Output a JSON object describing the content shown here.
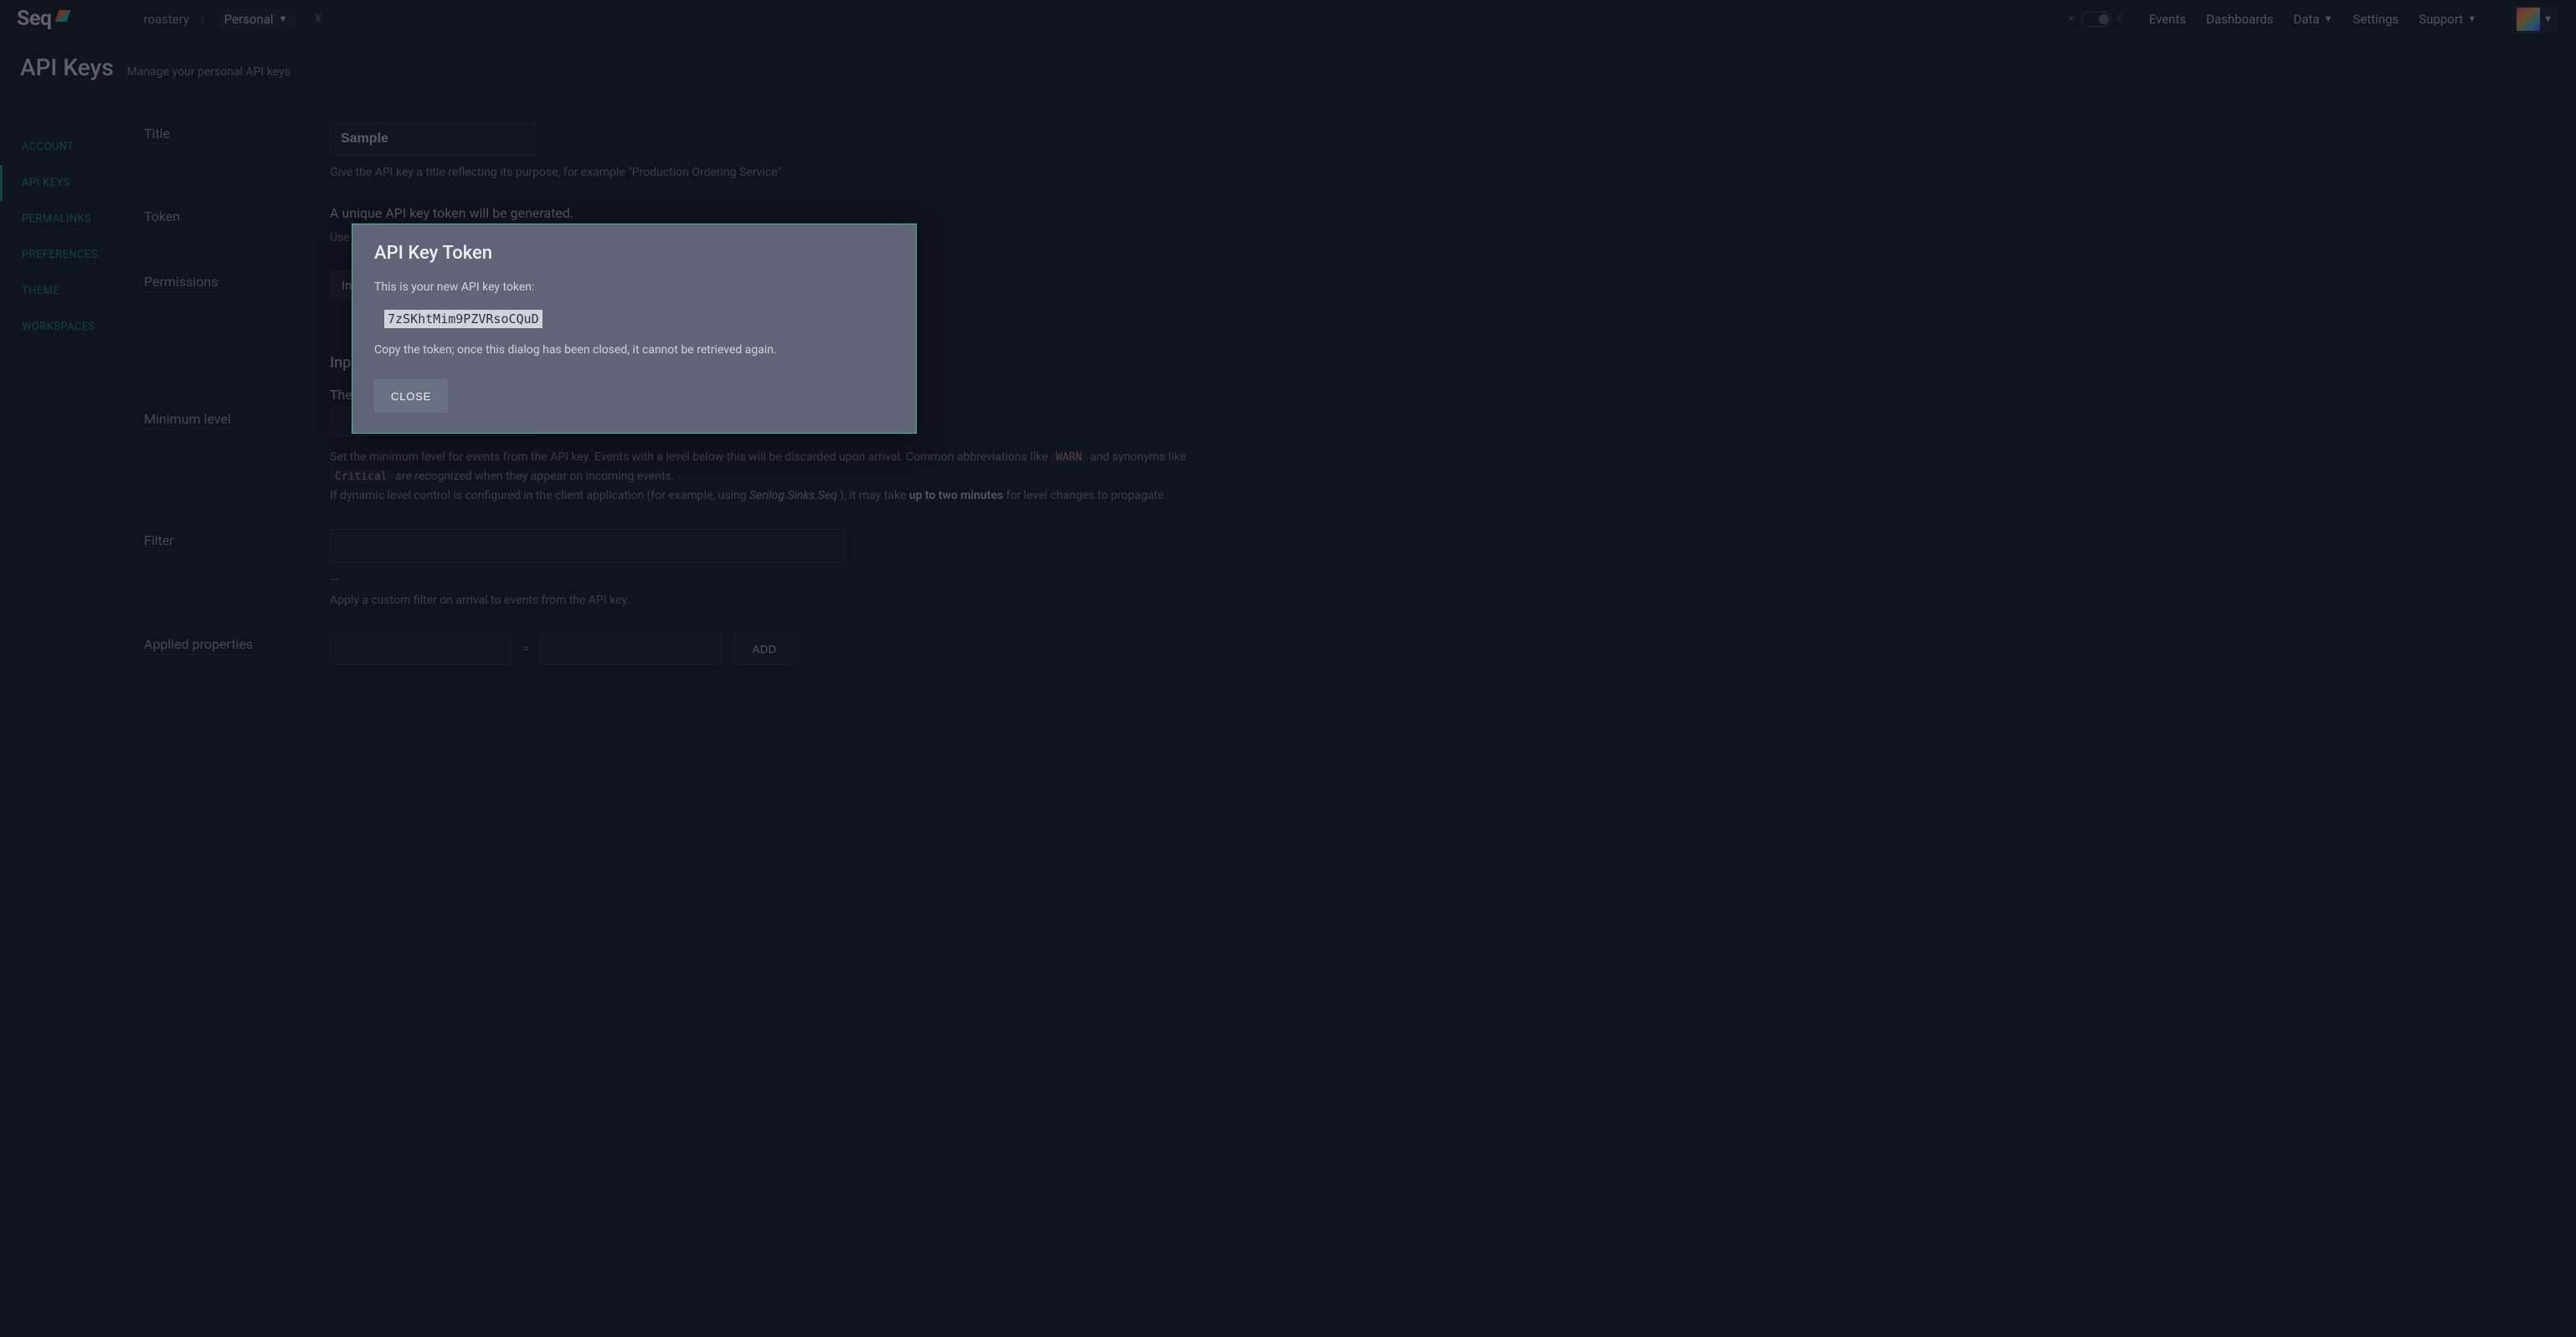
{
  "topnav": {
    "logo_text": "Seq",
    "workspace": "roastery",
    "scope": "Personal",
    "links": {
      "events": "Events",
      "dashboards": "Dashboards",
      "data": "Data",
      "settings": "Settings",
      "support": "Support"
    }
  },
  "page": {
    "title": "API Keys",
    "subtitle": "Manage your personal API keys"
  },
  "sidebar": {
    "items": [
      {
        "label": "ACCOUNT"
      },
      {
        "label": "API KEYS"
      },
      {
        "label": "PERMALINKS"
      },
      {
        "label": "PREFERENCES"
      },
      {
        "label": "THEME"
      },
      {
        "label": "WORKSPACES"
      }
    ]
  },
  "form": {
    "title": {
      "label": "Title",
      "value": "Sample",
      "help": "Give the API key a title reflecting its purpose, for example \"Production Ordering Service\"."
    },
    "token": {
      "label": "Token",
      "headline": "A unique API key token will be generated.",
      "help_prefix": "Use"
    },
    "permissions": {
      "label": "Permissions",
      "chip_prefix": "Ing"
    },
    "input_section_prefix": "Inp",
    "input_section_body_prefix": "The",
    "min_level": {
      "label": "Minimum level",
      "help_1a": "Set the minimum level for events from the API key. Events with a level below this will be discarded upon arrival. Common abbreviations like ",
      "code1": "WARN",
      "help_1b": " and synonyms like ",
      "code2": "Critical",
      "help_1c": " are recognized when they appear on incoming events.",
      "help_2a": "If dynamic level control is configured in the client application (for example, using ",
      "em": "Serilog.Sinks.Seq",
      "help_2b": "), it may take ",
      "strong": "up to two minutes",
      "help_2c": " for level changes to propagate."
    },
    "filter": {
      "label": "Filter",
      "ellipsis": "…",
      "help": "Apply a custom filter on arrival to events from the API key."
    },
    "applied_properties": {
      "label": "Applied properties",
      "eq": "=",
      "add": "ADD"
    }
  },
  "modal": {
    "title": "API Key Token",
    "intro": "This is your new API key token:",
    "token": "7zSKhtMim9PZVRsoCQuD",
    "warn": "Copy the token; once this dialog has been closed, it cannot be retrieved again.",
    "close": "CLOSE"
  }
}
